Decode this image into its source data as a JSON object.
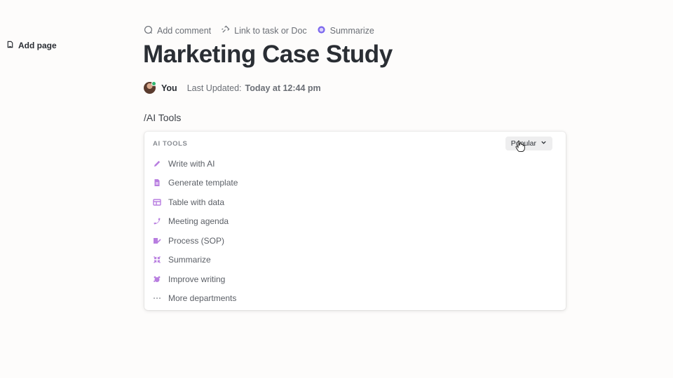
{
  "sidebar": {
    "add_page_label": "Add page"
  },
  "toolbar": {
    "add_comment": "Add comment",
    "link_task": "Link to task or Doc",
    "summarize": "Summarize"
  },
  "page": {
    "title": "Marketing Case Study",
    "author": "You",
    "updated_label": "Last Updated:",
    "updated_value": "Today at 12:44 pm"
  },
  "editor": {
    "slash_text": "/AI Tools"
  },
  "ai_menu": {
    "section_label": "AI TOOLS",
    "filter_label": "Popular",
    "accent_color": "#b87ee0",
    "items": [
      {
        "label": "Write with AI",
        "icon": "pencil-icon"
      },
      {
        "label": "Generate template",
        "icon": "document-icon"
      },
      {
        "label": "Table with data",
        "icon": "table-icon"
      },
      {
        "label": "Meeting agenda",
        "icon": "phone-icon"
      },
      {
        "label": "Process (SOP)",
        "icon": "process-edit-icon"
      },
      {
        "label": "Summarize",
        "icon": "collapse-arrows-icon"
      },
      {
        "label": "Improve writing",
        "icon": "sparkle-blob-icon"
      },
      {
        "label": "More departments",
        "icon": "ellipsis-icon"
      }
    ]
  }
}
